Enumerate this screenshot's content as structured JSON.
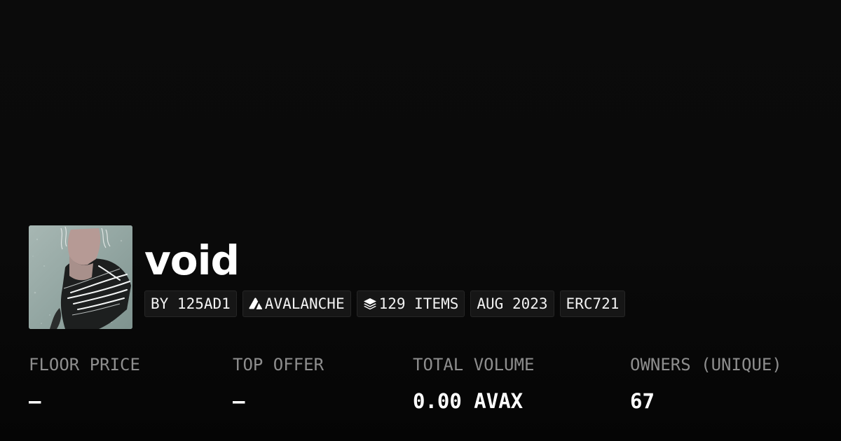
{
  "collection": {
    "name": "void",
    "tags": {
      "creator": "BY 125AD1",
      "chain": "AVALANCHE",
      "items": "129 ITEMS",
      "date": "AUG 2023",
      "standard": "ERC721"
    },
    "icons": {
      "chain": "avalanche-logo-icon",
      "items": "layers-icon"
    }
  },
  "stats": {
    "floor_price": {
      "label": "FLOOR PRICE",
      "value": "–"
    },
    "top_offer": {
      "label": "TOP OFFER",
      "value": "–"
    },
    "total_volume": {
      "label": "TOTAL VOLUME",
      "value": "0.00 AVAX"
    },
    "owners": {
      "label": "OWNERS (UNIQUE)",
      "value": "67"
    }
  },
  "colors": {
    "background": "#0a0a0a",
    "tag_background": "#161616",
    "label_gray": "#8e8e8e",
    "text": "#ffffff"
  }
}
